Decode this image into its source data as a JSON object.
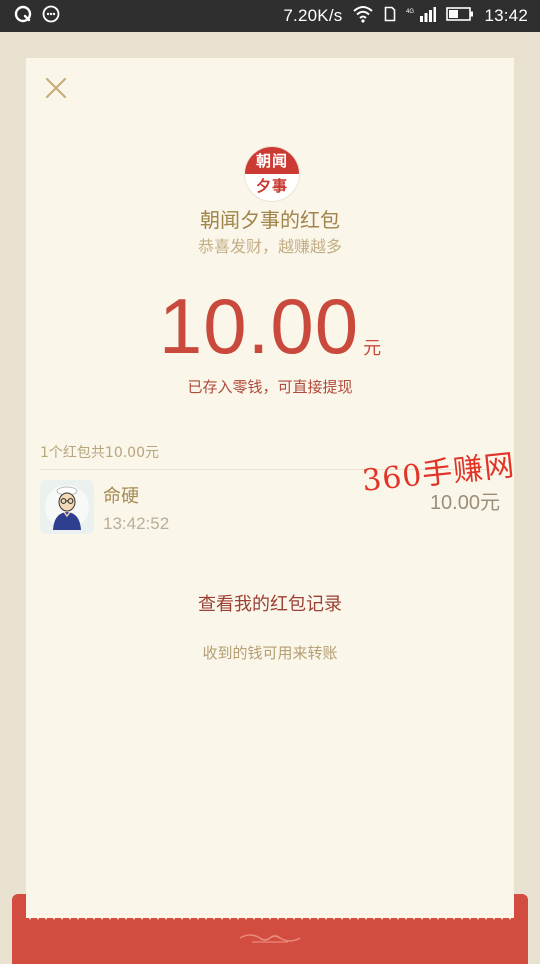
{
  "status_bar": {
    "speed": "7.20K/s",
    "time": "13:42",
    "network_badge": "4G"
  },
  "card": {
    "logo": {
      "top_text": "朝闻",
      "bottom_text": "夕事"
    },
    "sender_title": "朝闻夕事的红包",
    "greeting": "恭喜发财，越赚越多",
    "amount": "10.00",
    "currency": "元",
    "deposit_note": "已存入零钱，可直接提现",
    "summary": "1个红包共10.00元",
    "records": [
      {
        "name": "命硬",
        "time": "13:42:52",
        "amount": "10.00元"
      }
    ],
    "view_records_label": "查看我的红包记录",
    "transfer_note": "收到的钱可用来转账"
  },
  "watermark": "360手赚网",
  "colors": {
    "accent_red": "#c94a3c",
    "envelope_red": "#d24c3f",
    "gold_text": "#a08449",
    "card_bg": "#faf6ea",
    "page_bg": "#e9e2d1"
  },
  "icons": [
    "qq-icon",
    "chat-bubble-icon",
    "wifi-icon",
    "sim-card-icon",
    "signal-icon",
    "battery-icon",
    "close-icon"
  ]
}
